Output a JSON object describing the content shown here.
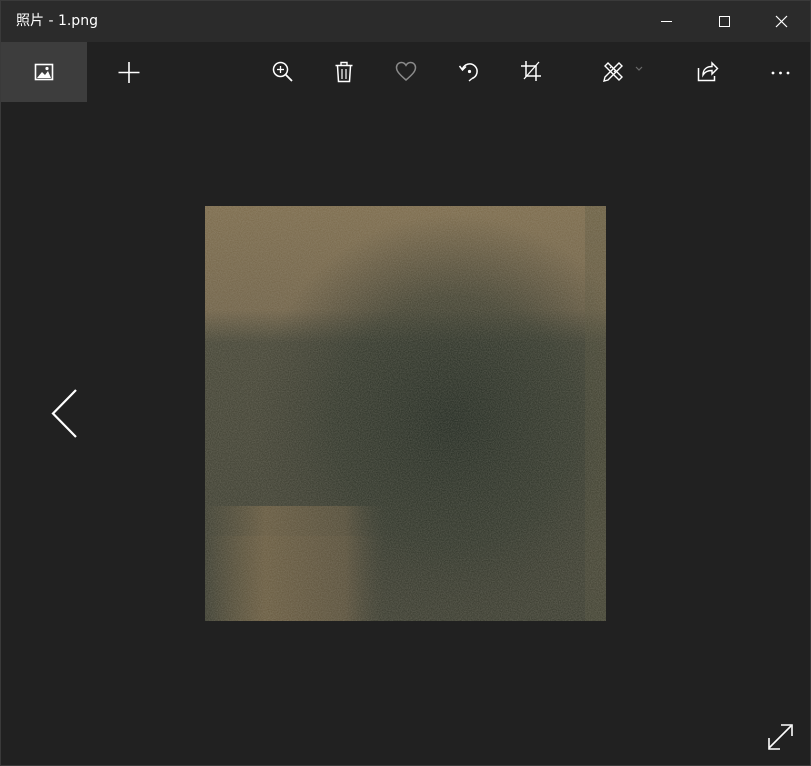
{
  "window": {
    "title": "照片 - 1.png",
    "controls": {
      "minimize": "minimize-icon",
      "maximize": "maximize-icon",
      "close": "close-icon"
    }
  },
  "toolbar": {
    "left": [
      {
        "name": "collection",
        "icon": "picture-icon",
        "active": true
      },
      {
        "name": "add",
        "icon": "plus-icon"
      }
    ],
    "actions": [
      {
        "name": "zoom",
        "icon": "zoom-in-icon"
      },
      {
        "name": "delete",
        "icon": "trash-icon"
      },
      {
        "name": "favorite",
        "icon": "heart-icon"
      },
      {
        "name": "rotate",
        "icon": "rotate-icon"
      },
      {
        "name": "crop",
        "icon": "crop-icon"
      },
      {
        "name": "edit-create",
        "icon": "pencil-ruler-icon",
        "has_dropdown": true
      },
      {
        "name": "share",
        "icon": "share-icon"
      },
      {
        "name": "more",
        "icon": "ellipsis-icon"
      }
    ]
  },
  "viewer": {
    "image_file": "1.png",
    "nav_prev_icon": "chevron-left-icon",
    "fullscreen_icon": "expand-diagonal-icon"
  },
  "colors": {
    "background": "#212121",
    "titlebar": "#2b2b2b",
    "active_tab": "#3d3d3d",
    "icon": "#ffffff",
    "icon_dim": "#8a8a8a"
  }
}
